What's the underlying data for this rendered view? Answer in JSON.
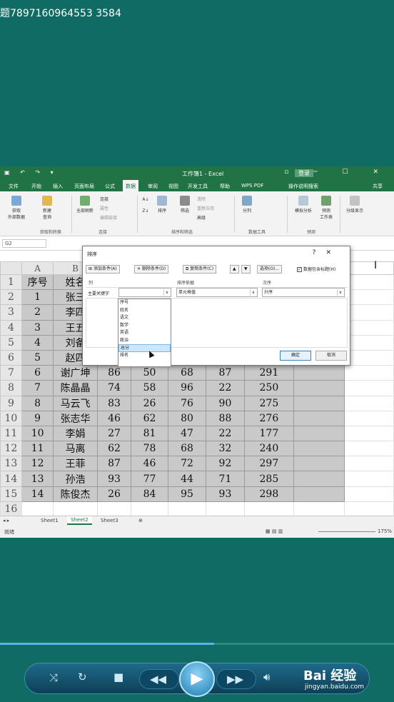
{
  "overlay_title": "题7897160964553 3584",
  "excel": {
    "doc_title": "工作簿1 - Excel",
    "login": "登录",
    "share": "共享",
    "tabs": [
      "文件",
      "开始",
      "插入",
      "页面布局",
      "公式",
      "数据",
      "审阅",
      "视图",
      "开发工具",
      "帮助",
      "WPS PDF",
      "操作说明搜索"
    ],
    "active_tab": "数据",
    "ribbon": {
      "get_data": "获取\n外部数据",
      "new_query": "新建\n查询",
      "refresh_all": "全部刷新",
      "connections": "连接",
      "properties": "属性",
      "edit_links": "编辑链接",
      "sort": "排序",
      "filter": "筛选",
      "clear": "清除",
      "reapply": "重新应用",
      "advanced": "高级",
      "split": "分列",
      "what_if": "模拟分析",
      "forecast": "预测\n工作表",
      "outline": "分级显示",
      "groups": [
        "获取和转换",
        "连接",
        "排序和筛选",
        "数据工具",
        "预测"
      ]
    },
    "name_box": "G2",
    "columns": [
      "A",
      "B",
      "C",
      "D",
      "E",
      "F",
      "G",
      "H"
    ],
    "header_row": [
      "序号",
      "姓名",
      "",
      "",
      "",
      "",
      "",
      ""
    ],
    "rows": [
      [
        "1",
        "张三",
        "",
        "",
        "",
        "",
        ""
      ],
      [
        "2",
        "李四",
        "",
        "",
        "",
        "",
        ""
      ],
      [
        "3",
        "王五",
        "",
        "",
        "",
        "",
        ""
      ],
      [
        "4",
        "刘备",
        "",
        "",
        "",
        "",
        ""
      ],
      [
        "5",
        "赵四",
        "",
        "",
        "",
        "",
        ""
      ],
      [
        "6",
        "谢广坤",
        "86",
        "50",
        "68",
        "87",
        "291"
      ],
      [
        "7",
        "陈晶晶",
        "74",
        "58",
        "96",
        "22",
        "250"
      ],
      [
        "8",
        "马云飞",
        "83",
        "26",
        "76",
        "90",
        "275"
      ],
      [
        "9",
        "张志华",
        "46",
        "62",
        "80",
        "88",
        "276"
      ],
      [
        "10",
        "李娟",
        "27",
        "81",
        "47",
        "22",
        "177"
      ],
      [
        "11",
        "马离",
        "62",
        "78",
        "68",
        "32",
        "240"
      ],
      [
        "12",
        "王菲",
        "87",
        "46",
        "72",
        "92",
        "297"
      ],
      [
        "13",
        "孙浩",
        "93",
        "77",
        "44",
        "71",
        "285"
      ],
      [
        "14",
        "陈俊杰",
        "26",
        "84",
        "95",
        "93",
        "298"
      ]
    ],
    "sheets": [
      "Sheet1",
      "Sheet2",
      "Sheet3"
    ],
    "active_sheet": "Sheet2",
    "status_left": "就绪",
    "zoom": "175%"
  },
  "sort_dialog": {
    "title": "排序",
    "help": "?",
    "close": "✕",
    "add_level": "添加条件(A)",
    "delete_level": "删除条件(D)",
    "copy_level": "复制条件(C)",
    "options": "选项(O)...",
    "has_headers": "数据包含标题(H)",
    "col_header": "列",
    "sort_on_header": "排序依据",
    "order_header": "次序",
    "row_label": "主要关键字",
    "sort_on_value": "单元格值",
    "order_value": "升序",
    "ok": "确定",
    "cancel": "取消"
  },
  "dropdown_items": [
    "序号",
    "姓名",
    "语文",
    "数学",
    "英语",
    "政治",
    "总分",
    "排名"
  ],
  "dropdown_highlight": "总分",
  "watermark": {
    "brand": "Bai 经验",
    "url": "jingyan.baidu.com"
  }
}
